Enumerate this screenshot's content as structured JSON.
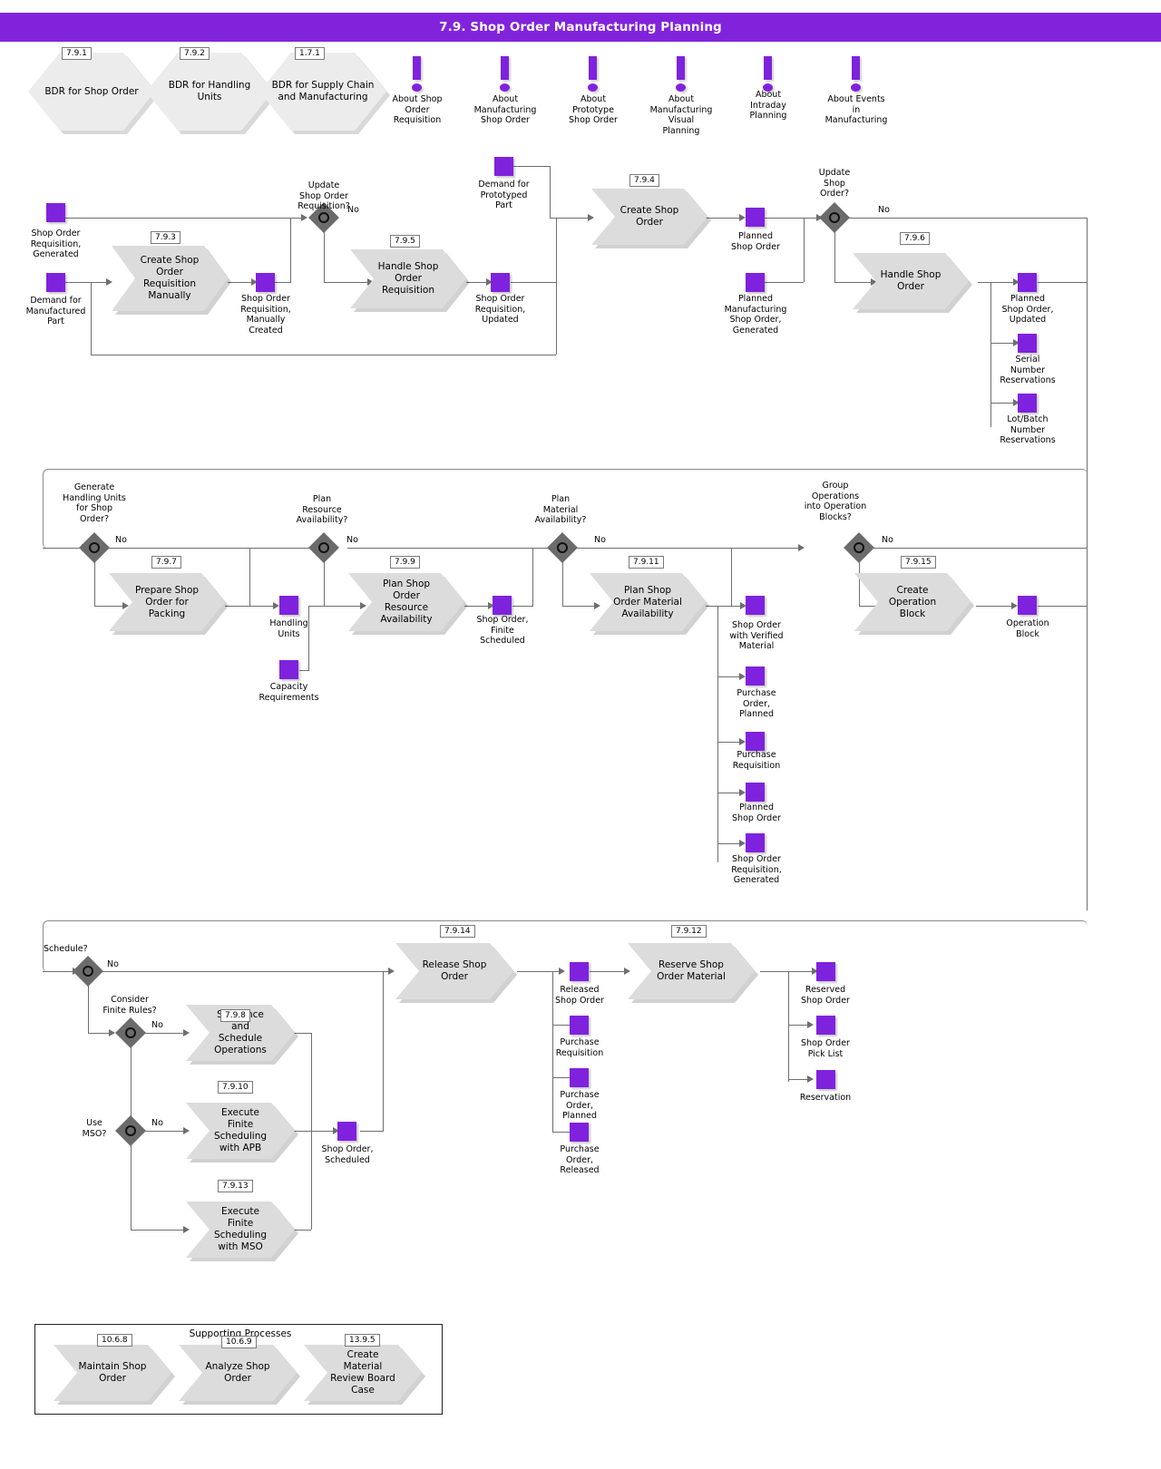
{
  "header": {
    "title": "7.9. Shop Order Manufacturing Planning",
    "bar_color": "#8223dc"
  },
  "colors": {
    "accent": "#7f22dd",
    "process_fill": "#dcdcdc",
    "hex_fill": "#ececec",
    "gateway_fill": "#6b6b6b",
    "line": "#6e6e6e"
  },
  "bdr": [
    {
      "id": "7.9.1",
      "label": "BDR for Shop Order"
    },
    {
      "id": "7.9.2",
      "label": "BDR for Handling\nUnits"
    },
    {
      "id": "1.7.1",
      "label": "BDR for Supply\nChain and\nManufacturing"
    }
  ],
  "events": [
    {
      "label": "About Shop\nOrder\nRequisition"
    },
    {
      "label": "About\nManufacturing\nShop Order"
    },
    {
      "label": "About\nPrototype\nShop Order"
    },
    {
      "label": "About\nManufacturing\nVisual\nPlanning"
    },
    {
      "label": "About\nIntraday\nPlanning"
    },
    {
      "label": "About Events\nin\nManufacturing"
    }
  ],
  "processes": {
    "p793": {
      "id": "7.9.3",
      "label": "Create Shop\nOrder\nRequisition\nManually"
    },
    "p795": {
      "id": "7.9.5",
      "label": "Handle Shop\nOrder\nRequisition"
    },
    "p794": {
      "id": "7.9.4",
      "label": "Create Shop\nOrder"
    },
    "p796": {
      "id": "7.9.6",
      "label": "Handle Shop\nOrder"
    },
    "p797": {
      "id": "7.9.7",
      "label": "Prepare Shop\nOrder for\nPacking"
    },
    "p799": {
      "id": "7.9.9",
      "label": "Plan Shop Order\nResource\nAvailability"
    },
    "p7911": {
      "id": "7.9.11",
      "label": "Plan Shop Order\nMaterial\nAvailability"
    },
    "p7915": {
      "id": "7.9.15",
      "label": "Create\nOperation Block"
    },
    "p798": {
      "id": "7.9.8",
      "label": "Sequence and\nSchedule\nOperations"
    },
    "p7910": {
      "id": "7.9.10",
      "label": "Execute Finite\nScheduling with\nAPB"
    },
    "p7913": {
      "id": "7.9.13",
      "label": "Execute Finite\nScheduling with\nMSO"
    },
    "p7914": {
      "id": "7.9.14",
      "label": "Release Shop\nOrder"
    },
    "p7912": {
      "id": "7.9.12",
      "label": "Reserve Shop\nOrder Material"
    }
  },
  "gateways": {
    "g_update_sor": {
      "label": "Update\nShop Order\nRequisition?",
      "no": "No"
    },
    "g_update_so": {
      "label": "Update\nShop\nOrder?",
      "no": "No"
    },
    "g_gen_hu": {
      "label": "Generate\nHandling Units\nfor Shop\nOrder?",
      "no": "No"
    },
    "g_plan_res": {
      "label": "Plan\nResource\nAvailability?",
      "no": "No"
    },
    "g_plan_mat": {
      "label": "Plan\nMaterial\nAvailability?",
      "no": "No"
    },
    "g_group_ops": {
      "label": "Group\nOperations\ninto Operation\nBlocks?",
      "no": "No"
    },
    "g_schedule": {
      "label": "Schedule?",
      "no": "No"
    },
    "g_finite_rules": {
      "label": "Consider\nFinite Rules?",
      "no": "No"
    },
    "g_use_mso": {
      "label": "Use\nMSO?",
      "no": "No"
    }
  },
  "objects": {
    "o_sor_generated": "Shop Order\nRequisition,\nGenerated",
    "o_demand_manu": "Demand for\nManufactured\nPart",
    "o_sor_manual": "Shop Order\nRequisition,\nManually\nCreated",
    "o_sor_updated": "Shop Order\nRequisition,\nUpdated",
    "o_demand_proto": "Demand for\nPrototyped\nPart",
    "o_planned_so": "Planned\nShop Order",
    "o_planned_mso_gen": "Planned\nManufacturing\nShop Order,\nGenerated",
    "o_planned_so_upd": "Planned\nShop Order,\nUpdated",
    "o_serial_res": "Serial\nNumber\nReservations",
    "o_lot_res": "Lot/Batch\nNumber\nReservations",
    "o_handling_units": "Handling\nUnits",
    "o_capacity_req": "Capacity\nRequirements",
    "o_so_finite": "Shop Order,\nFinite\nScheduled",
    "o_so_verified": "Shop Order\nwith Verified\nMaterial",
    "o_po_planned": "Purchase\nOrder,\nPlanned",
    "o_purch_req": "Purchase\nRequisition",
    "o_planned_so2": "Planned\nShop Order",
    "o_sor_generated2": "Shop Order\nRequisition,\nGenerated",
    "o_operation_block": "Operation\nBlock",
    "o_so_scheduled": "Shop Order,\nScheduled",
    "o_released_so": "Released\nShop Order",
    "o_purch_req2": "Purchase\nRequisition",
    "o_po_planned2": "Purchase\nOrder,\nPlanned",
    "o_po_released": "Purchase\nOrder,\nReleased",
    "o_reserved_so": "Reserved\nShop Order",
    "o_so_picklist": "Shop Order\nPick List",
    "o_reservation": "Reservation"
  },
  "supporting": {
    "title": "Supporting Processes",
    "items": [
      {
        "id": "10.6.8",
        "label": "Maintain Shop\nOrder"
      },
      {
        "id": "10.6.9",
        "label": "Analyze Shop\nOrder"
      },
      {
        "id": "13.9.5",
        "label": "Create Material\nReview Board\nCase"
      }
    ]
  }
}
